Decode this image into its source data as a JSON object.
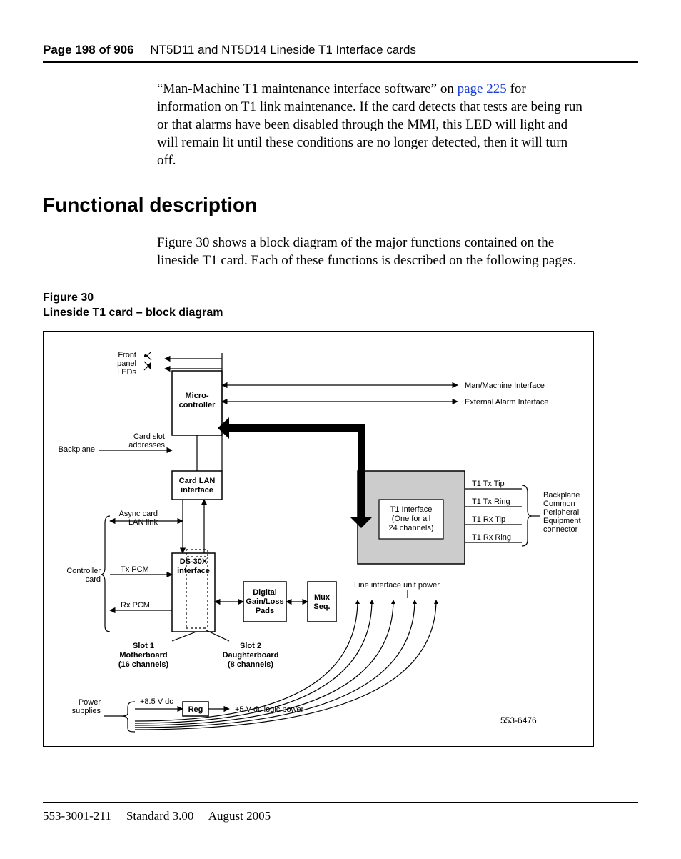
{
  "header": {
    "page": "Page 198 of 906",
    "title": "NT5D11 and NT5D14 Lineside T1 Interface cards"
  },
  "body": {
    "para1_a": "“Man-Machine T1 maintenance interface software” on ",
    "para1_link": "page 225",
    "para1_b": " for information on T1 link maintenance. If the card detects that tests are being run or that alarms have been disabled through the MMI, this LED will light and will remain lit until these conditions are no longer detected, then it will turn off.",
    "heading": "Functional description",
    "para2": "Figure 30 shows a block diagram of the major functions contained on the lineside T1 card. Each of these functions is described on the following pages."
  },
  "figure": {
    "num": "Figure 30",
    "title": "Lineside T1 card – block diagram"
  },
  "diagram": {
    "front_leds": "Front\npanel\nLEDs",
    "micro": "Micro-\ncontroller",
    "card_slot": "Card slot\naddresses",
    "backplane": "Backplane",
    "card_lan": "Card LAN\ninterface",
    "async": "Async card\nLAN link",
    "controller": "Controller\ncard",
    "tx_pcm": "Tx PCM",
    "rx_pcm": "Rx PCM",
    "ds30x": "DS-30X\ninterface",
    "gain": "Digital\nGain/Loss\nPads",
    "mux": "Mux\nSeq.",
    "t1if": "T1 Interface\n(One for all\n24 channels)",
    "mmi": "Man/Machine Interface",
    "eai": "External Alarm Interface",
    "t1_tx_tip": "T1 Tx Tip",
    "t1_tx_ring": "T1 Tx Ring",
    "t1_rx_tip": "T1 Rx Tip",
    "t1_rx_ring": "T1 Rx Ring",
    "bp_conn": "Backplane\nCommon\nPeripheral\nEquipment\nconnector",
    "slot1": "Slot 1\nMotherboard\n(16 channels)",
    "slot2": "Slot 2\nDaughterboard\n(8 channels)",
    "liu_power": "Line interface unit power",
    "power_supplies": "Power\nsupplies",
    "v85": "+8.5 V dc",
    "reg": "Reg",
    "v5": "+5 V dc logic power",
    "partno": "553-6476"
  },
  "footer": {
    "doc": "553-3001-211",
    "rev": "Standard 3.00",
    "date": "August 2005"
  }
}
